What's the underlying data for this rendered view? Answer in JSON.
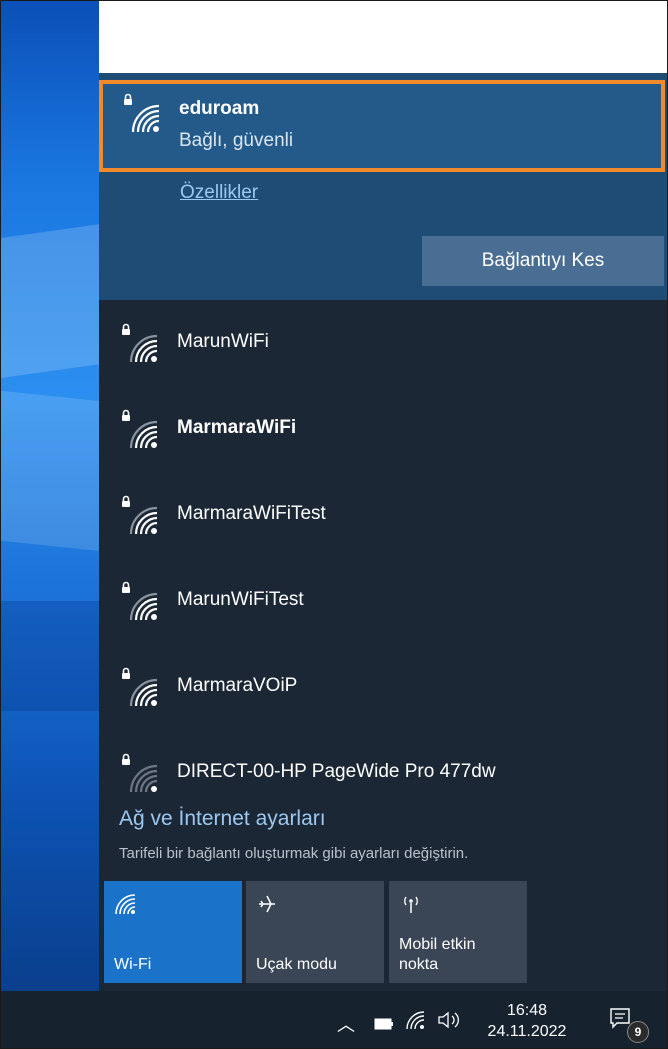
{
  "connected": {
    "name": "eduroam",
    "status": "Bağlı, güvenli",
    "properties_link": "Özellikler",
    "disconnect_label": "Bağlantıyı Kes"
  },
  "networks": [
    {
      "name": "MarunWiFi",
      "icon": "secured-wifi-icon"
    },
    {
      "name": "MarmaraWiFi",
      "icon": "secured-wifi-icon"
    },
    {
      "name": "MarmaraWiFiTest",
      "icon": "secured-wifi-icon"
    },
    {
      "name": "MarunWiFiTest",
      "icon": "secured-wifi-icon"
    },
    {
      "name": "MarmaraVOiP",
      "icon": "secured-wifi-icon"
    },
    {
      "name": "DIRECT-00-HP PageWide Pro 477dw",
      "icon": "secured-wifi-weak-icon"
    }
  ],
  "settings": {
    "link": "Ağ ve İnternet ayarları",
    "description": "Tarifeli bir bağlantı oluşturmak gibi ayarları değiştirin."
  },
  "quick_actions": [
    {
      "label": "Wi-Fi",
      "icon": "wifi-icon",
      "active": true
    },
    {
      "label": "Uçak modu",
      "icon": "airplane-icon",
      "active": false
    },
    {
      "label": "Mobil etkin nokta",
      "icon": "hotspot-icon",
      "active": false
    }
  ],
  "taskbar": {
    "time": "16:48",
    "date": "24.11.2022",
    "notification_count": "9"
  },
  "colors": {
    "flyout_bg": "#1c2735",
    "connected_bg": "#235a8a",
    "highlight_border": "#f08a2a",
    "active_tile": "#1a73c9",
    "link": "#9cc8f0"
  }
}
